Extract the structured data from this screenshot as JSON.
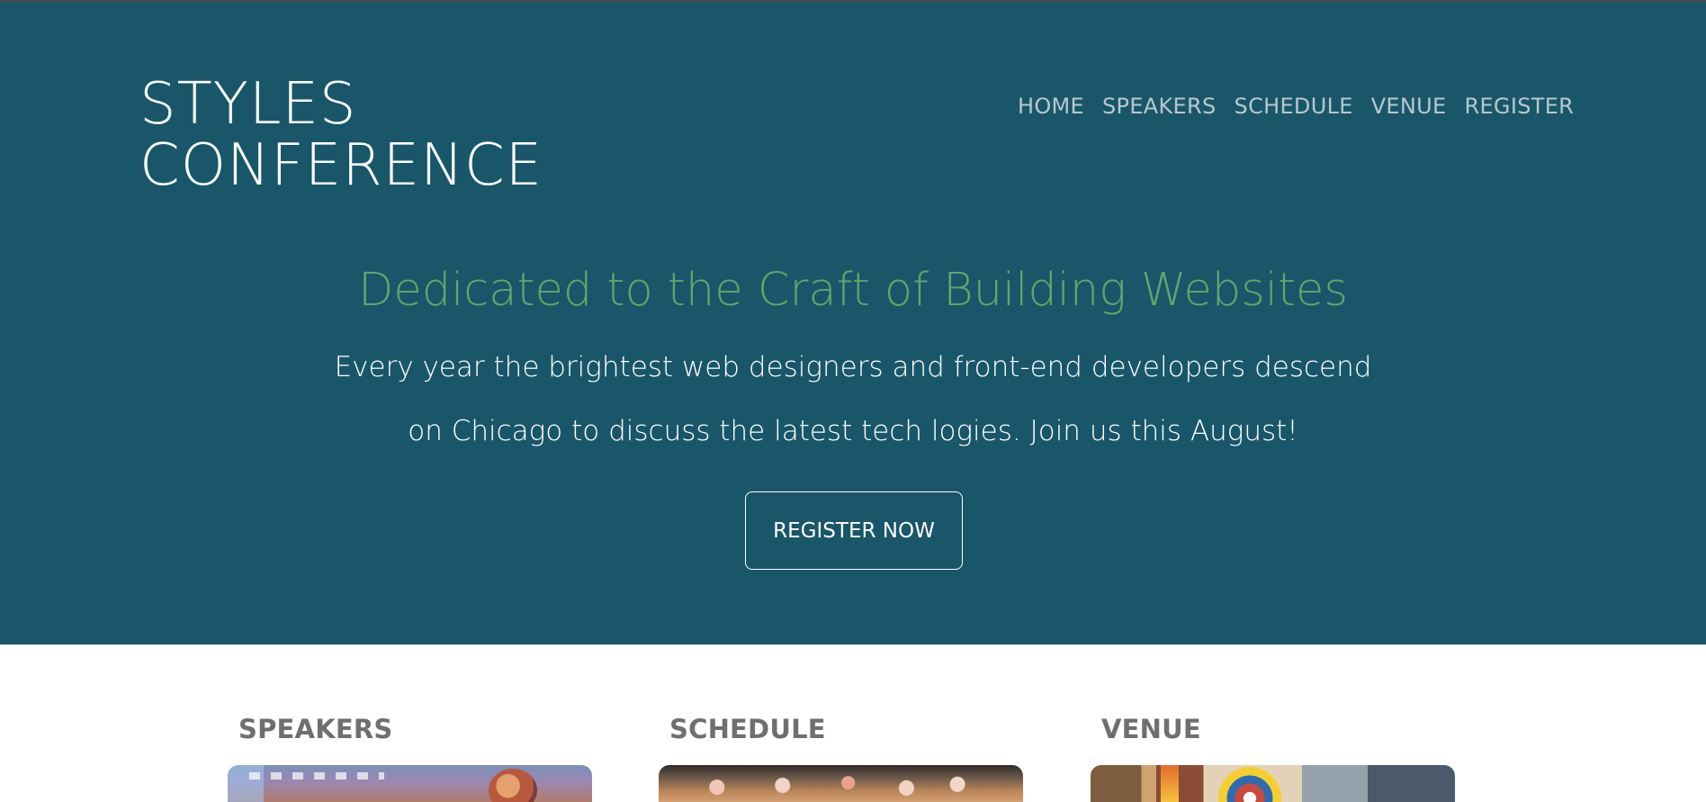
{
  "site": {
    "logo": {
      "line1": "STYLES",
      "line2": "CONFERENCE"
    },
    "nav": [
      {
        "label": "HOME"
      },
      {
        "label": "SPEAKERS"
      },
      {
        "label": "SCHEDULE"
      },
      {
        "label": "VENUE"
      },
      {
        "label": "REGISTER"
      }
    ]
  },
  "hero": {
    "headline": "Dedicated to the Craft of Building Websites",
    "intro": "Every year the brightest web designers and front-end developers descend on Chicago to discuss the latest tech logies. Join us this August!",
    "cta": "REGISTER NOW"
  },
  "features": [
    {
      "title": "SPEAKERS",
      "image": "speaker-photo"
    },
    {
      "title": "SCHEDULE",
      "image": "audience-photo"
    },
    {
      "title": "VENUE",
      "image": "venue-photo"
    }
  ],
  "colors": {
    "hero_background": "#195669",
    "headline_accent": "#5ca86d",
    "nav_text": "#b8c7cf",
    "feature_title": "#6f6f6f"
  }
}
